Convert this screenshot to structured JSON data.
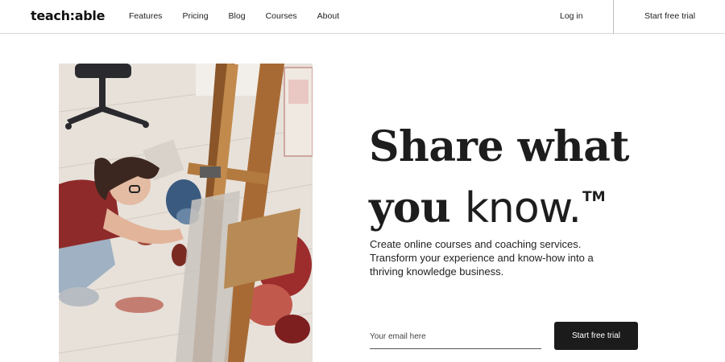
{
  "header": {
    "logo": "teach:able",
    "nav": [
      "Features",
      "Pricing",
      "Blog",
      "Courses",
      "About"
    ],
    "login": "Log in",
    "cta": "Start free trial"
  },
  "hero": {
    "headline_line1": "Share what",
    "headline_line2_serif": "you ",
    "headline_line2_sans": "know.",
    "trademark": "TM",
    "subcopy": [
      "Create online courses and coaching services.",
      "Transform your experience and know-how into a",
      "thriving knowledge business."
    ],
    "email_placeholder": "Your email here",
    "email_value": "",
    "cta": "Start free trial"
  },
  "image": {
    "icon": "photo-artist-painting-easel"
  }
}
